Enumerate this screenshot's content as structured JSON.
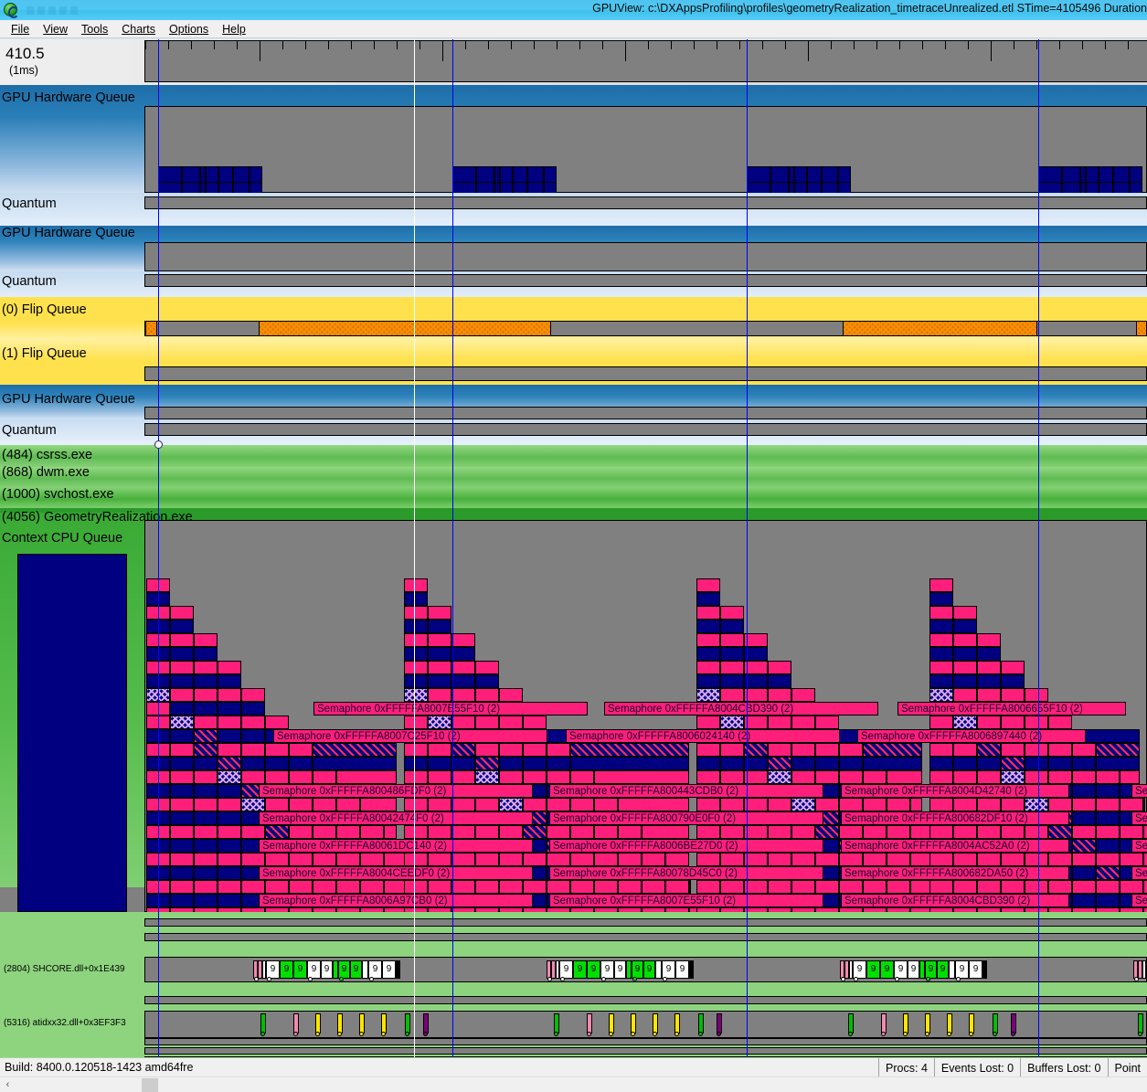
{
  "window": {
    "title": "GPUView: c:\\DXAppsProfiling\\profiles\\geometryRealization_timetraceUnrealized.etl STime=4105496 Duration",
    "app_icon": "gpuview-icon"
  },
  "menu": {
    "items": [
      {
        "label": "File",
        "accel": "F"
      },
      {
        "label": "View",
        "accel": "V"
      },
      {
        "label": "Tools",
        "accel": "T"
      },
      {
        "label": "Charts",
        "accel": "C"
      },
      {
        "label": "Options",
        "accel": "O"
      },
      {
        "label": "Help",
        "accel": "H"
      }
    ]
  },
  "ruler": {
    "value": "410.5",
    "unit": "(1ms)"
  },
  "tracks": [
    {
      "label": "GPU Hardware Queue",
      "kind": "hardware-queue"
    },
    {
      "label": "Quantum",
      "kind": "quantum"
    },
    {
      "label": "GPU Hardware Queue",
      "kind": "hardware-queue"
    },
    {
      "label": "Quantum",
      "kind": "quantum"
    },
    {
      "label": "(0) Flip Queue",
      "kind": "flip-queue"
    },
    {
      "label": "(1) Flip Queue",
      "kind": "flip-queue"
    },
    {
      "label": "GPU Hardware Queue",
      "kind": "hardware-queue"
    },
    {
      "label": "Quantum",
      "kind": "quantum"
    },
    {
      "label": "(484) csrss.exe",
      "kind": "process"
    },
    {
      "label": "(868) dwm.exe",
      "kind": "process"
    },
    {
      "label": "(1000) svchost.exe",
      "kind": "process"
    },
    {
      "label": "(4056) GeometryRealization.exe",
      "kind": "process"
    },
    {
      "label": "Context CPU Queue",
      "kind": "context-queue"
    }
  ],
  "threads": [
    {
      "label": "(2804) SHCORE.dll+0x1E439"
    },
    {
      "label": "(5316) atidxx32.dll+0x3EF3F3"
    }
  ],
  "semaphores": {
    "group1": [
      "Semaphore 0xFFFFFA8007E55F10 (2)",
      "Semaphore 0xFFFFFA8007C25F10 (2)",
      "Semaphore 0xFFFFFA800486FDF0 (2)",
      "Semaphore 0xFFFFFA80042474F0 (2)",
      "Semaphore 0xFFFFFA80061DC140 (2)",
      "Semaphore 0xFFFFFA8004CEEDF0 (2)",
      "Semaphore 0xFFFFFA8006A97CB0 (2)"
    ],
    "group2": [
      "Semaphore 0xFFFFFA8004CBD390 (2)",
      "Semaphore 0xFFFFFA8006024140 (2)",
      "Semaphore 0xFFFFFA800443CDB0 (2)",
      "Semaphore 0xFFFFFA800790E0F0 (2)",
      "Semaphore 0xFFFFFA8006BE27D0 (2)",
      "Semaphore 0xFFFFFA80078D45C0 (2)",
      "Semaphore 0xFFFFFA8007E55F10 (2)"
    ],
    "group3": [
      "Semaphore 0xFFFFFA8006655F10 (2)",
      "Semaphore 0xFFFFFA8006897440 (2)",
      "Semaphore 0xFFFFFA8004D42740 (2)",
      "Semaphore 0xFFFFFA800682DF10 (2)",
      "Semaphore 0xFFFFFA8004AC52A0 (2)",
      "Semaphore 0xFFFFFA800682DA50 (2)",
      "Semaphore 0xFFFFFA8004CBD390 (2)"
    ],
    "group4_truncated": [
      "Ser",
      "Ser",
      "Ser",
      "Ser",
      "Ser"
    ]
  },
  "marker_label": "9",
  "status": {
    "build": "Build: 8400.0.120518-1423  amd64fre",
    "cells": [
      "Procs: 4",
      "Events Lost: 0",
      "Buffers Lost: 0",
      "Point"
    ]
  },
  "scroll": {
    "left_arrow": "‹"
  },
  "colors": {
    "title_bg": "#4fc8f2",
    "pink": "#ff1f7a",
    "navy": "#000080",
    "cursor_blue": "#0000ff",
    "flip_yellow": "#ffe14d",
    "flip_orange": "#cc7a00",
    "green_process": "#2a9a2a",
    "track_gray": "#808080"
  }
}
